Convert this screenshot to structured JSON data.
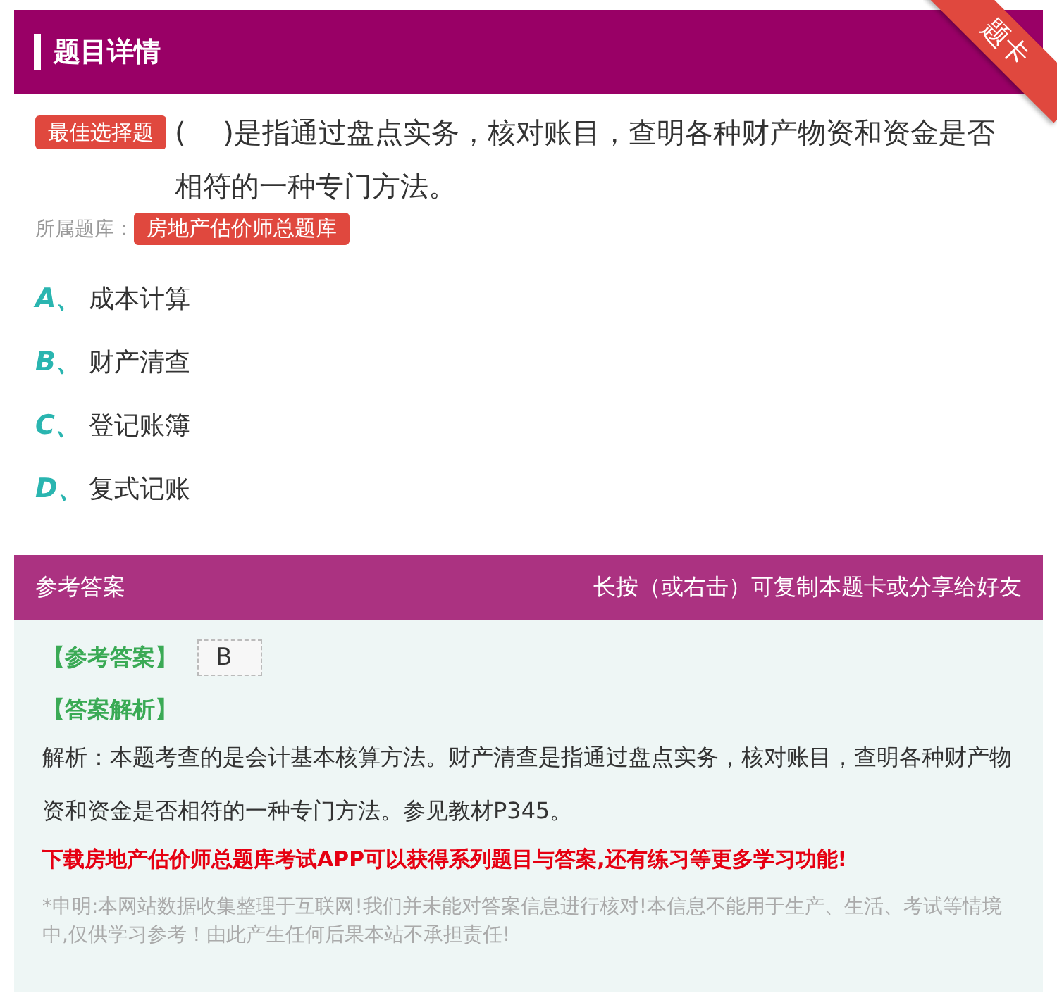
{
  "header": {
    "title": "题目详情",
    "corner_badge": "题卡"
  },
  "question": {
    "type_tag": "最佳选择题",
    "stem": "(　 )是指通过盘点实务，核对账目，查明各种财产物资和资金是否相符的一种专门方法。",
    "bank_label": "所属题库：",
    "bank_tag": "房地产估价师总题库"
  },
  "options": [
    {
      "letter": "A、",
      "text": "成本计算"
    },
    {
      "letter": "B、",
      "text": "财产清查"
    },
    {
      "letter": "C、",
      "text": "登记账簿"
    },
    {
      "letter": "D、",
      "text": "复式记账"
    }
  ],
  "answer_bar": {
    "title": "参考答案",
    "hint": "长按（或右击）可复制本题卡或分享给好友"
  },
  "answer": {
    "label": "【参考答案】",
    "value": "B",
    "analysis_label": "【答案解析】",
    "analysis": "解析：本题考查的是会计基本核算方法。财产清查是指通过盘点实务，核对账目，查明各种财产物资和资金是否相符的一种专门方法。参见教材P345。",
    "promo": "下载房地产估价师总题库考试APP可以获得系列题目与答案,还有练习等更多学习功能!",
    "disclaimer": "*申明:本网站数据收集整理于互联网!我们并未能对答案信息进行核对!本信息不能用于生产、生活、考试等情境中,仅供学习参考！由此产生任何后果本站不承担责任!"
  }
}
